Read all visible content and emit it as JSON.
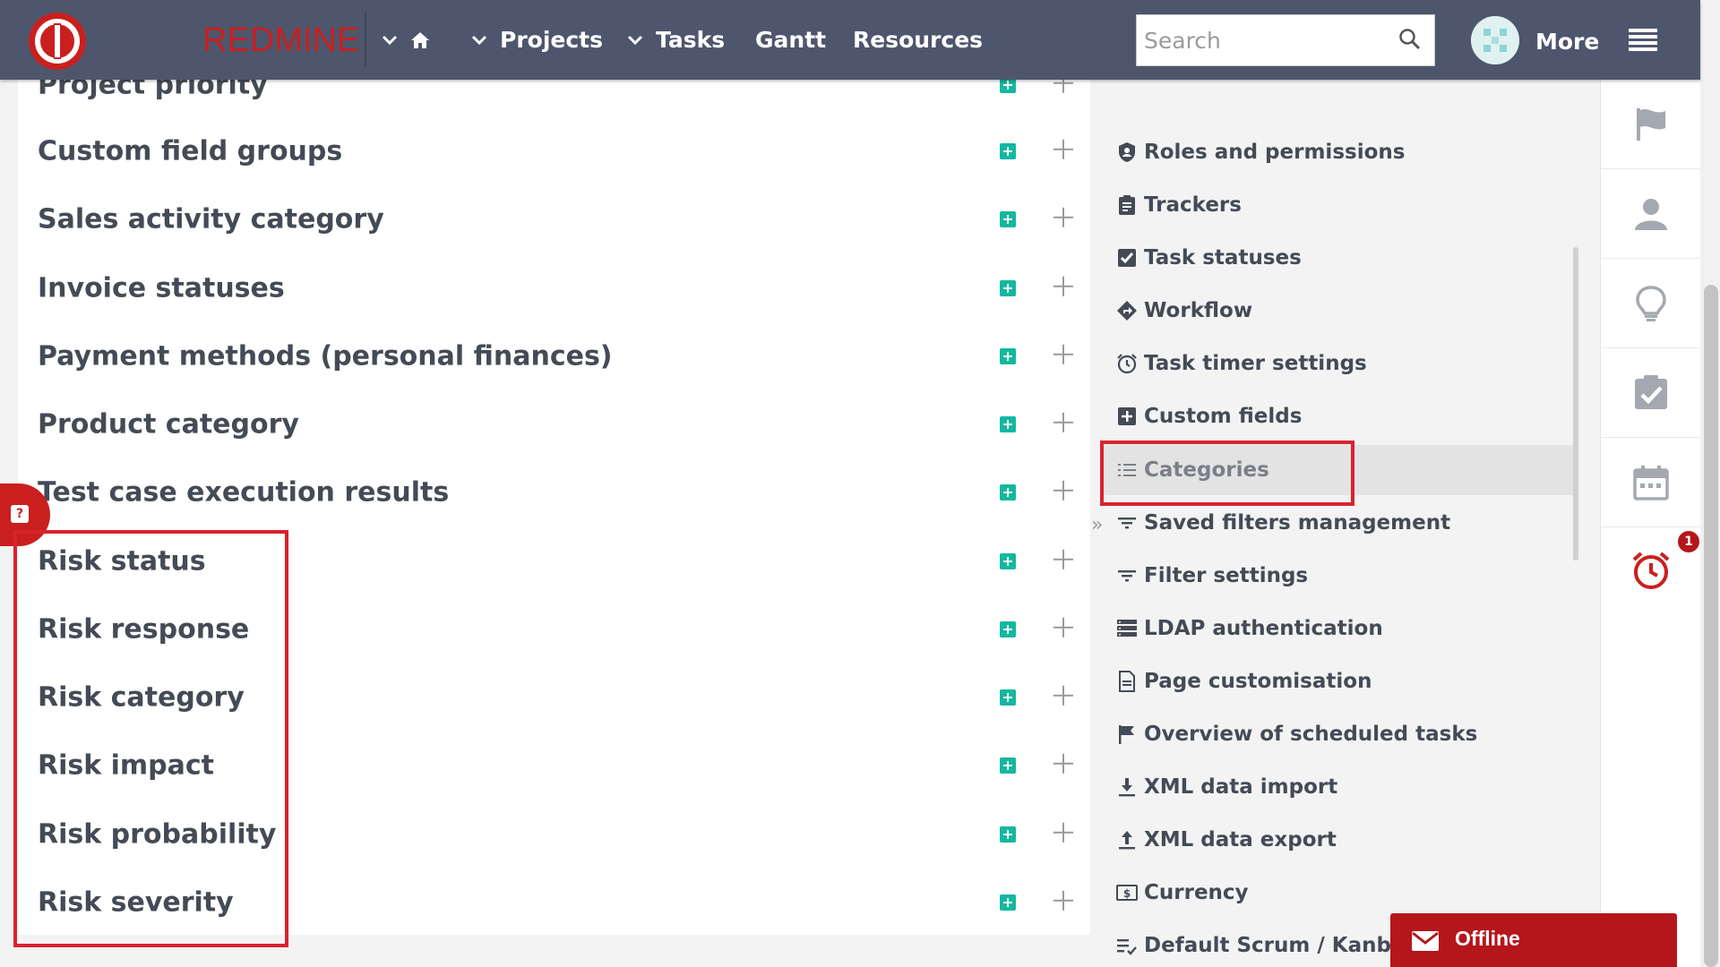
{
  "topbar": {
    "brand": "REDMINE",
    "nav": [
      {
        "label": "",
        "icon": "home-icon"
      },
      {
        "label": "Projects"
      },
      {
        "label": "Tasks"
      },
      {
        "label": "Gantt"
      },
      {
        "label": "Resources"
      }
    ],
    "search_placeholder": "Search",
    "more_label": "More",
    "colors": {
      "bar": "#4e566d",
      "brand": "#c9201f"
    }
  },
  "main": {
    "rows": [
      {
        "label": "Project priority"
      },
      {
        "label": "Custom field groups"
      },
      {
        "label": "Sales activity category"
      },
      {
        "label": "Invoice statuses"
      },
      {
        "label": "Payment methods (personal finances)"
      },
      {
        "label": "Product category"
      },
      {
        "label": "Test case execution results"
      },
      {
        "label": "Risk status"
      },
      {
        "label": "Risk response"
      },
      {
        "label": "Risk category"
      },
      {
        "label": "Risk impact"
      },
      {
        "label": "Risk probability"
      },
      {
        "label": "Risk severity"
      }
    ],
    "add_color": "#14b89e",
    "help_icon": "question-icon"
  },
  "menu": {
    "expand_glyph": "»",
    "items": [
      {
        "label": "Roles and permissions",
        "icon": "shield-user-icon"
      },
      {
        "label": "Trackers",
        "icon": "clipboard-icon"
      },
      {
        "label": "Task statuses",
        "icon": "checkbox-icon"
      },
      {
        "label": "Workflow",
        "icon": "diamond-arrow-icon"
      },
      {
        "label": "Task timer settings",
        "icon": "alarm-icon"
      },
      {
        "label": "Custom fields",
        "icon": "plus-square-icon"
      },
      {
        "label": "Categories",
        "icon": "list-icon",
        "active": true
      },
      {
        "label": "Saved filters management",
        "icon": "filter-icon"
      },
      {
        "label": "Filter settings",
        "icon": "filter-icon"
      },
      {
        "label": "LDAP authentication",
        "icon": "server-icon"
      },
      {
        "label": "Page customisation",
        "icon": "document-icon"
      },
      {
        "label": "Overview of scheduled tasks",
        "icon": "flag-icon"
      },
      {
        "label": "XML data import",
        "icon": "download-icon"
      },
      {
        "label": "XML data export",
        "icon": "upload-icon"
      },
      {
        "label": "Currency",
        "icon": "currency-icon"
      },
      {
        "label": "Default Scrum / Kanban s",
        "icon": "list-check-icon"
      }
    ],
    "highlight_color": "#d9232e"
  },
  "strip": {
    "buttons": [
      {
        "icon": "flag-icon"
      },
      {
        "icon": "user-icon"
      },
      {
        "icon": "lightbulb-icon"
      },
      {
        "icon": "clipboard-check-icon"
      },
      {
        "icon": "calendar-icon"
      },
      {
        "icon": "alarm-clock-icon",
        "badge": "1"
      }
    ]
  },
  "chat": {
    "label": "Offline",
    "icon": "envelope-icon",
    "color": "#b5161b"
  }
}
